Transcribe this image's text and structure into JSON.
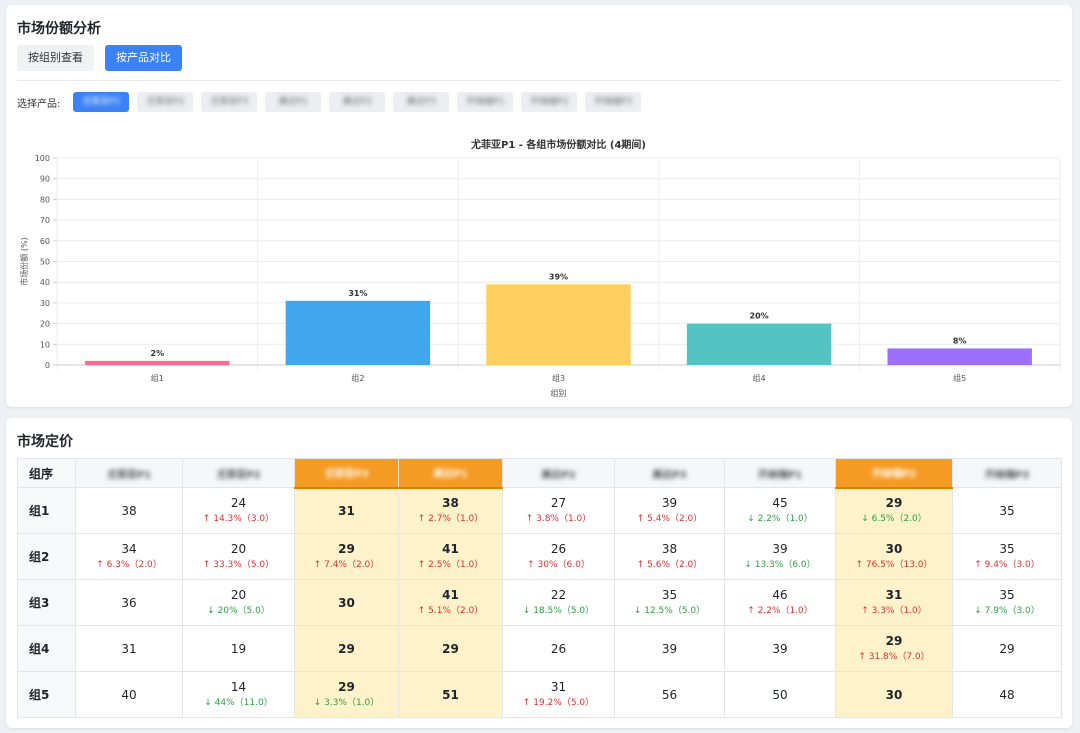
{
  "section1": {
    "title": "市场份额分析",
    "tabs": [
      {
        "label": "按组别查看",
        "active": false
      },
      {
        "label": "按产品对比",
        "active": true
      }
    ],
    "selector_label": "选择产品:",
    "products": [
      {
        "label": "尤菲亚P1",
        "active": true
      },
      {
        "label": "尤菲亚P2",
        "active": false
      },
      {
        "label": "尤菲亚P3",
        "active": false
      },
      {
        "label": "美达P1",
        "active": false
      },
      {
        "label": "美达P2",
        "active": false
      },
      {
        "label": "美达P3",
        "active": false
      },
      {
        "label": "开纳瑞P1",
        "active": false
      },
      {
        "label": "开纳瑞P2",
        "active": false
      },
      {
        "label": "开纳瑞P3",
        "active": false
      }
    ]
  },
  "chart_data": {
    "type": "bar",
    "title": "尤菲亚P1 - 各组市场份额对比 (4期间)",
    "xlabel": "组别",
    "ylabel": "市场份额 (%)",
    "ylim": [
      0,
      100
    ],
    "yticks": [
      0,
      10,
      20,
      30,
      40,
      50,
      60,
      70,
      80,
      90,
      100
    ],
    "categories": [
      "组1",
      "组2",
      "组3",
      "组4",
      "组5"
    ],
    "values": [
      2,
      31,
      39,
      20,
      8
    ],
    "value_labels": [
      "2%",
      "31%",
      "39%",
      "20%",
      "8%"
    ],
    "colors": [
      "#ff6384",
      "#36a2eb",
      "#ffce56",
      "#4bc0c0",
      "#9966ff"
    ],
    "grid": true,
    "legend": "none"
  },
  "section2": {
    "title": "市场定价",
    "corner_header": "组序",
    "columns": [
      {
        "label": "尤菲亚P1",
        "highlight": false
      },
      {
        "label": "尤菲亚P2",
        "highlight": false
      },
      {
        "label": "尤菲亚P3",
        "highlight": true
      },
      {
        "label": "美达P1",
        "highlight": true
      },
      {
        "label": "美达P2",
        "highlight": false
      },
      {
        "label": "美达P3",
        "highlight": false
      },
      {
        "label": "开纳瑞P1",
        "highlight": false
      },
      {
        "label": "开纳瑞P2",
        "highlight": true
      },
      {
        "label": "开纳瑞P3",
        "highlight": false
      }
    ],
    "rows": [
      {
        "group": "组1",
        "cells": [
          {
            "value": "38"
          },
          {
            "value": "24",
            "change": "↑ 14.3%（3.0）",
            "dir": "up"
          },
          {
            "value": "31"
          },
          {
            "value": "38",
            "change": "↑ 2.7%（1.0）",
            "dir": "up"
          },
          {
            "value": "27",
            "change": "↑ 3.8%（1.0）",
            "dir": "up"
          },
          {
            "value": "39",
            "change": "↑ 5.4%（2.0）",
            "dir": "up"
          },
          {
            "value": "45",
            "change": "↓ 2.2%（1.0）",
            "dir": "down"
          },
          {
            "value": "29",
            "change": "↓ 6.5%（2.0）",
            "dir": "down"
          },
          {
            "value": "35"
          }
        ]
      },
      {
        "group": "组2",
        "cells": [
          {
            "value": "34",
            "change": "↑ 6.3%（2.0）",
            "dir": "up"
          },
          {
            "value": "20",
            "change": "↑ 33.3%（5.0）",
            "dir": "up"
          },
          {
            "value": "29",
            "change": "↑ 7.4%（2.0）",
            "dir": "up"
          },
          {
            "value": "41",
            "change": "↑ 2.5%（1.0）",
            "dir": "up"
          },
          {
            "value": "26",
            "change": "↑ 30%（6.0）",
            "dir": "up"
          },
          {
            "value": "38",
            "change": "↑ 5.6%（2.0）",
            "dir": "up"
          },
          {
            "value": "39",
            "change": "↓ 13.3%（6.0）",
            "dir": "down"
          },
          {
            "value": "30",
            "change": "↑ 76.5%（13.0）",
            "dir": "up"
          },
          {
            "value": "35",
            "change": "↑ 9.4%（3.0）",
            "dir": "up"
          }
        ]
      },
      {
        "group": "组3",
        "cells": [
          {
            "value": "36"
          },
          {
            "value": "20",
            "change": "↓ 20%（5.0）",
            "dir": "down"
          },
          {
            "value": "30"
          },
          {
            "value": "41",
            "change": "↑ 5.1%（2.0）",
            "dir": "up"
          },
          {
            "value": "22",
            "change": "↓ 18.5%（5.0）",
            "dir": "down"
          },
          {
            "value": "35",
            "change": "↓ 12.5%（5.0）",
            "dir": "down"
          },
          {
            "value": "46",
            "change": "↑ 2.2%（1.0）",
            "dir": "up"
          },
          {
            "value": "31",
            "change": "↑ 3.3%（1.0）",
            "dir": "up"
          },
          {
            "value": "35",
            "change": "↓ 7.9%（3.0）",
            "dir": "down"
          }
        ]
      },
      {
        "group": "组4",
        "cells": [
          {
            "value": "31"
          },
          {
            "value": "19"
          },
          {
            "value": "29"
          },
          {
            "value": "29"
          },
          {
            "value": "26"
          },
          {
            "value": "39"
          },
          {
            "value": "39"
          },
          {
            "value": "29",
            "change": "↑ 31.8%（7.0）",
            "dir": "up"
          },
          {
            "value": "29"
          }
        ]
      },
      {
        "group": "组5",
        "cells": [
          {
            "value": "40"
          },
          {
            "value": "14",
            "change": "↓ 44%（11.0）",
            "dir": "down"
          },
          {
            "value": "29",
            "change": "↓ 3.3%（1.0）",
            "dir": "down"
          },
          {
            "value": "51"
          },
          {
            "value": "31",
            "change": "↑ 19.2%（5.0）",
            "dir": "up"
          },
          {
            "value": "56"
          },
          {
            "value": "50"
          },
          {
            "value": "30"
          },
          {
            "value": "48"
          }
        ]
      }
    ]
  }
}
